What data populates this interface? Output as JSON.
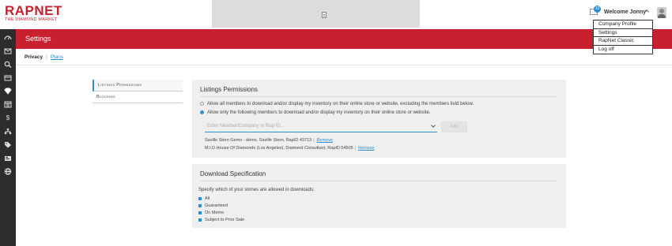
{
  "header": {
    "logo_main": "RAPNET",
    "logo_sub": "THE DIAMOND MARKET",
    "notification_count": "10",
    "welcome": "Welcome Jonny"
  },
  "user_menu": {
    "items": [
      {
        "label": "Company Profile"
      },
      {
        "label": "Settings"
      },
      {
        "label": "RapNet Classic"
      },
      {
        "label": "Log off"
      }
    ]
  },
  "sidebar": {
    "icons": [
      "dashboard-icon",
      "mail-icon",
      "search-icon",
      "inventory-icon",
      "diamond-icon",
      "calendar-icon",
      "dollar-icon",
      "network-icon",
      "tag-icon",
      "card-icon",
      "globe-icon"
    ]
  },
  "page": {
    "title": "Settings",
    "subnav_active": "Privacy",
    "subnav_link": "Plans"
  },
  "tabs": [
    {
      "label": "Listings Permissions"
    },
    {
      "label": "Blocking"
    }
  ],
  "listings": {
    "title": "Listings Permissions",
    "option_all": "Allow all members to download and/or display my inventory on their online store or website, excluding the members listd below.",
    "option_only": "Allow only the following members to download and/or display my inventory on their online store or website.",
    "input_placeholder": "Enter Member/Company or Rap ID...",
    "add_label": "Add",
    "members": [
      {
        "text": "Saville Stern Gems - demo, Saville Stern, RapID 43713",
        "remove": "Remove"
      },
      {
        "text": "M.I.D House Of Diamonds (Los Angeles), Diamond Consultant, RapID 54505",
        "remove": "Remove"
      }
    ]
  },
  "download_spec": {
    "title": "Download Specification",
    "intro": "Specify which of your stones are allowed in downloads:",
    "options": [
      {
        "label": "All"
      },
      {
        "label": "Guaranteed"
      },
      {
        "label": "On Memo"
      },
      {
        "label": "Subject to Prior Sale"
      }
    ]
  },
  "colors": {
    "brand_red": "#c8202f",
    "accent_blue": "#2b8fd6",
    "sidebar_dark": "#2c2c2c"
  }
}
